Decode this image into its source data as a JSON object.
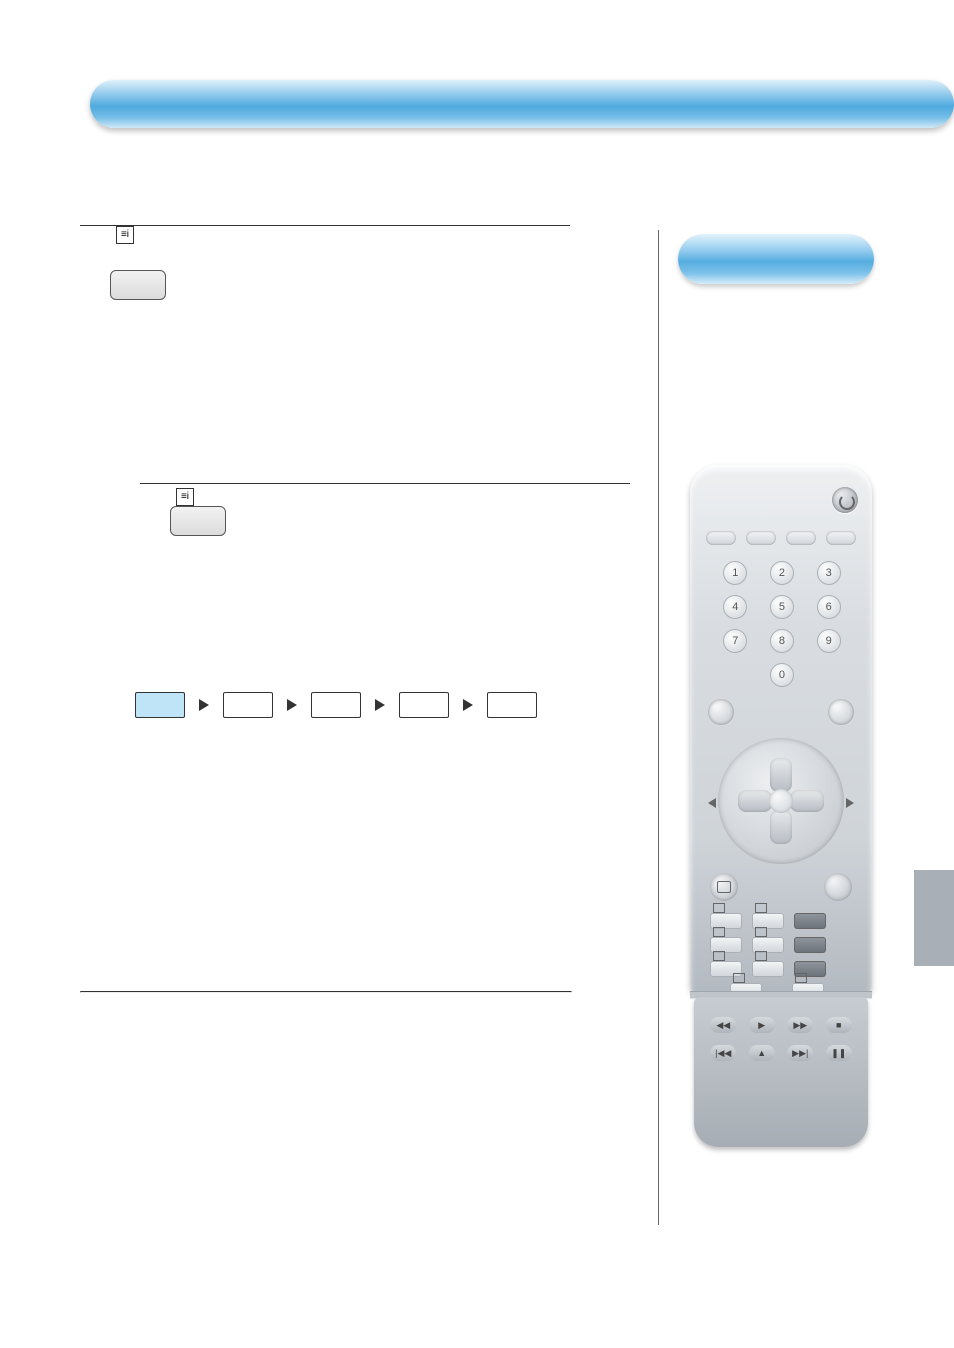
{
  "header": {
    "title": ""
  },
  "pill": {
    "label": ""
  },
  "icons": {
    "ei_glyph": "≡i"
  },
  "keypad": [
    "1",
    "2",
    "3",
    "4",
    "5",
    "6",
    "7",
    "8",
    "9",
    "",
    "0",
    ""
  ],
  "transport": {
    "row1": [
      "◀◀",
      "▶",
      "▶▶",
      "■"
    ],
    "row2": [
      "|◀◀",
      "▲",
      "▶▶|",
      "❚❚"
    ]
  }
}
